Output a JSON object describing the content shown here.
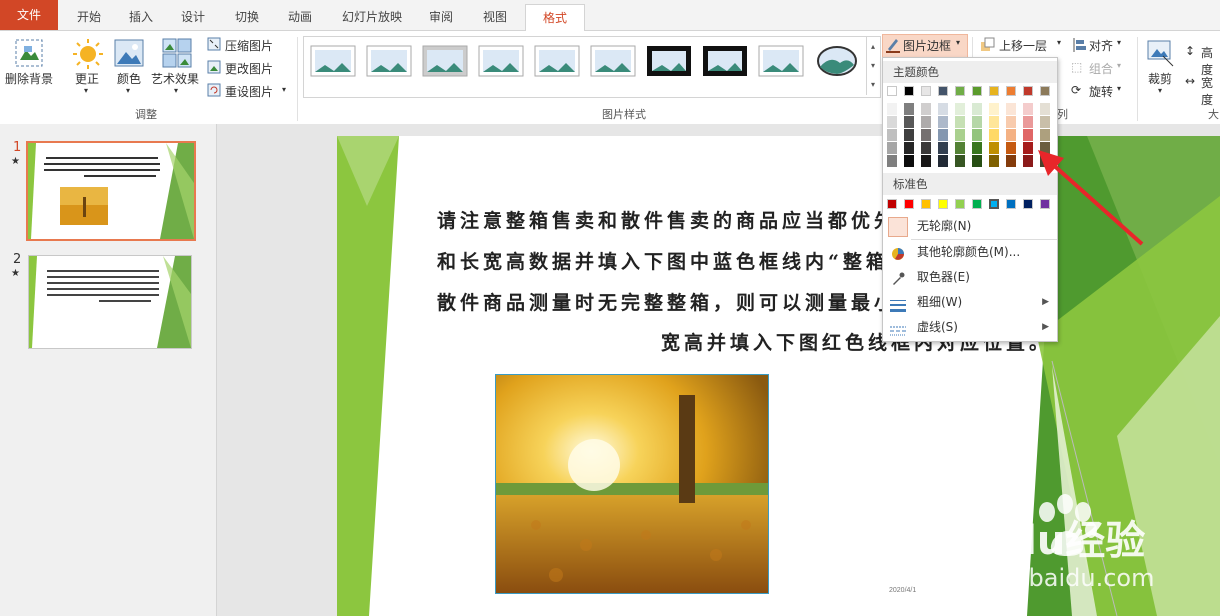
{
  "tabs": [
    "文件",
    "开始",
    "插入",
    "设计",
    "切换",
    "动画",
    "幻灯片放映",
    "审阅",
    "视图",
    "格式"
  ],
  "ribbon": {
    "remove_bg": "删除背景",
    "correct": "更正",
    "color": "颜色",
    "art_effect": "艺术效果",
    "compress": "压缩图片",
    "change": "更改图片",
    "reset": "重设图片",
    "group_adjust": "调整",
    "group_styles": "图片样式",
    "border": "图片边框",
    "bring_forward": "上移一层",
    "align": "对齐",
    "group_btn": "组合",
    "rotate": "旋转",
    "crop": "裁剪",
    "height": "高度",
    "width": "宽度",
    "group_arrange_tail": "列",
    "group_size_tail": "大"
  },
  "colors": {
    "accent": "#d24726"
  },
  "thumbs": {
    "n1": "1",
    "n2": "2",
    "star": "★"
  },
  "slide": {
    "lines": [
      "请注意整箱售卖和散件售卖的商品应当都优先",
      "和长宽高数据并填入下图中蓝色框线内“整箱",
      "散件商品测量时无完整整箱，则可以测量最小",
      "宽高并填入下图红色线框内对应位置。"
    ],
    "date": "2020/4/1"
  },
  "dropdown": {
    "theme_colors": "主题颜色",
    "standard_colors": "标准色",
    "no_outline": "无轮廓(N)",
    "more_colors": "其他轮廓颜色(M)...",
    "eyedropper": "取色器(E)",
    "weight": "粗细(W)",
    "dashes": "虚线(S)",
    "theme_top": [
      "#ffffff",
      "#000000",
      "#e7e6e6",
      "#44546a",
      "#70ad47",
      "#5b9b2c",
      "#e6b31e",
      "#ed7d31",
      "#c0392b",
      "#8c7a5a"
    ],
    "standard": [
      "#c00000",
      "#ff0000",
      "#ffc000",
      "#ffff00",
      "#92d050",
      "#00b050",
      "#00b0f0",
      "#0070c0",
      "#002060",
      "#7030a0"
    ]
  },
  "watermark": {
    "brand": "Baidu经验",
    "url": "jingyan.baidu.com"
  }
}
